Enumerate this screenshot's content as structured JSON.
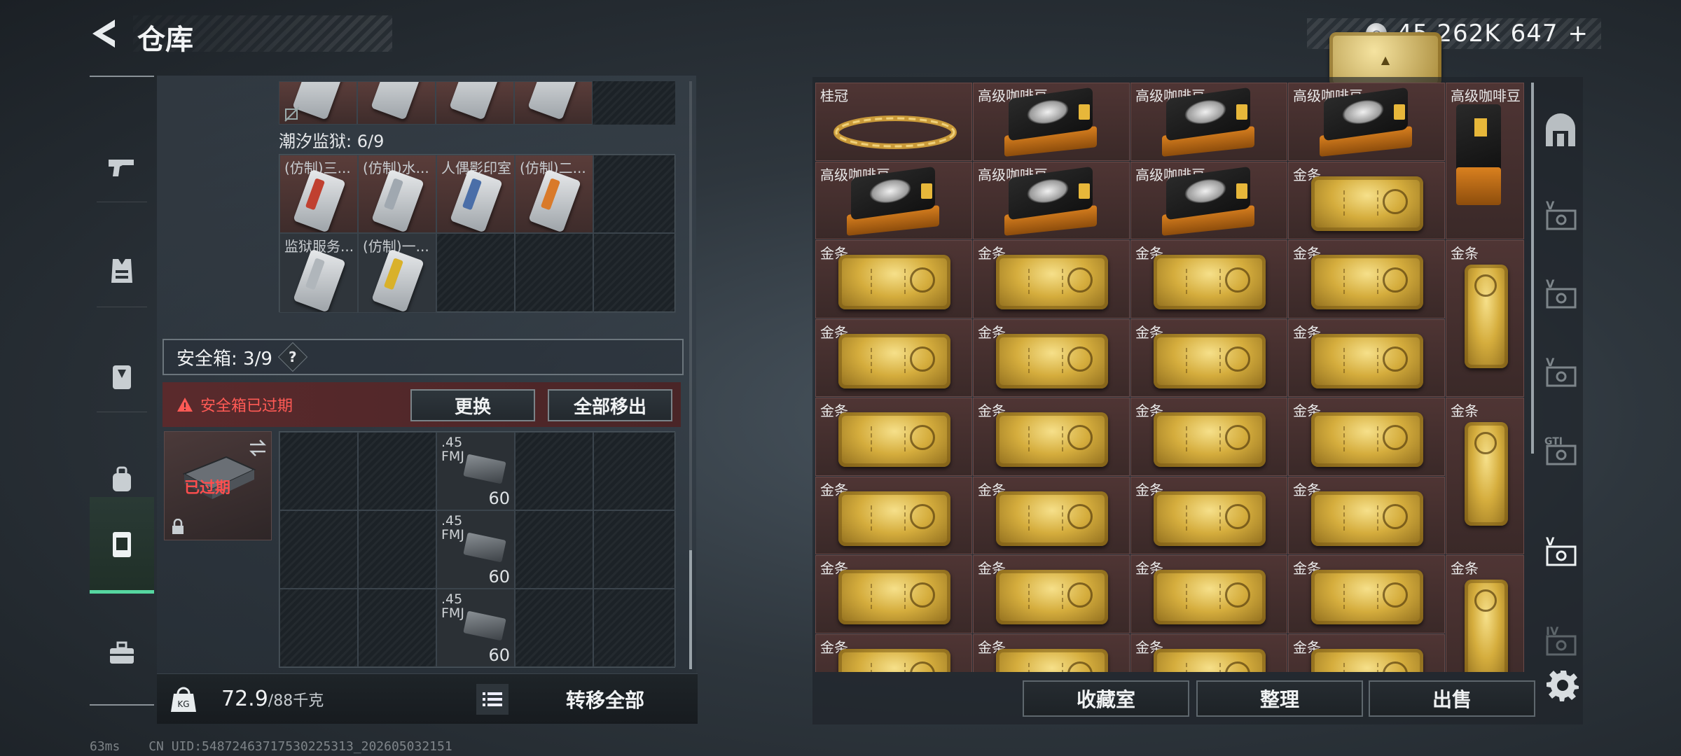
{
  "header": {
    "title": "仓库",
    "currency_silver": "45,262K",
    "currency_gold": "647",
    "add_symbol": "+"
  },
  "left_panel": {
    "prison_label": "潮汐监狱: 6/9",
    "prison_items": [
      {
        "name": "(仿制)三..."
      },
      {
        "name": "(仿制)水..."
      },
      {
        "name": "人偶影印室"
      },
      {
        "name": "(仿制)二..."
      },
      {
        "name": "监狱服务..."
      },
      {
        "name": "(仿制)一..."
      }
    ],
    "safebox_label": "安全箱: 3/9",
    "safebox_help": "?",
    "expired_warning": "安全箱已过期",
    "replace_button": "更换",
    "move_all_out_button": "全部移出",
    "safebox_status": "已过期",
    "ammo": [
      {
        "caliber": ".45",
        "type": "FMJ",
        "count": "60"
      },
      {
        "caliber": ".45",
        "type": "FMJ",
        "count": "60"
      },
      {
        "caliber": ".45",
        "type": "FMJ",
        "count": "60"
      }
    ],
    "weight_current": "72.9",
    "weight_max": "/88千克",
    "transfer_all_button": "转移全部"
  },
  "right_panel": {
    "items": [
      {
        "name": "桂冠",
        "kind": "crown"
      },
      {
        "name": "高级咖啡豆",
        "kind": "coffee"
      },
      {
        "name": "高级咖啡豆",
        "kind": "coffee"
      },
      {
        "name": "高级咖啡豆",
        "kind": "coffee"
      },
      {
        "name": "高级咖啡豆",
        "kind": "coffee-vertical"
      },
      {
        "name": "高级咖啡豆",
        "kind": "coffee"
      },
      {
        "name": "高级咖啡豆",
        "kind": "coffee"
      },
      {
        "name": "高级咖啡豆",
        "kind": "coffee"
      },
      {
        "name": "金条",
        "kind": "gold"
      },
      {
        "name": "金条",
        "kind": "gold"
      },
      {
        "name": "金条",
        "kind": "gold"
      },
      {
        "name": "金条",
        "kind": "gold"
      },
      {
        "name": "金条",
        "kind": "gold"
      },
      {
        "name": "金条",
        "kind": "gold-vertical"
      },
      {
        "name": "金条",
        "kind": "gold"
      },
      {
        "name": "金条",
        "kind": "gold"
      },
      {
        "name": "金条",
        "kind": "gold"
      },
      {
        "name": "金条",
        "kind": "gold"
      },
      {
        "name": "金条",
        "kind": "gold"
      },
      {
        "name": "金条",
        "kind": "gold"
      },
      {
        "name": "金条",
        "kind": "gold"
      },
      {
        "name": "金条",
        "kind": "gold"
      },
      {
        "name": "金条",
        "kind": "gold-vertical"
      },
      {
        "name": "金条",
        "kind": "gold"
      },
      {
        "name": "金条",
        "kind": "gold"
      },
      {
        "name": "金条",
        "kind": "gold"
      },
      {
        "name": "金条",
        "kind": "gold"
      },
      {
        "name": "金条",
        "kind": "gold"
      },
      {
        "name": "金条",
        "kind": "gold"
      },
      {
        "name": "金条",
        "kind": "gold"
      },
      {
        "name": "金条",
        "kind": "gold"
      },
      {
        "name": "金条",
        "kind": "gold-vertical"
      },
      {
        "name": "金条",
        "kind": "gold"
      },
      {
        "name": "金条",
        "kind": "gold"
      },
      {
        "name": "金条",
        "kind": "gold"
      },
      {
        "name": "金条",
        "kind": "gold"
      }
    ],
    "collection_button": "收藏室",
    "sort_button": "整理",
    "sell_button": "出售"
  },
  "left_nav": [
    "pistol-icon",
    "vest-icon",
    "backpack-icon",
    "rig-icon",
    "safebox-icon",
    "toolbox-icon"
  ],
  "right_nav_labels": [
    "V",
    "V",
    "V",
    "GTI",
    "V",
    "IV"
  ],
  "status": {
    "ping": "63ms",
    "uid": "CN UID:5487246371753022531​3_202605032151"
  },
  "colors": {
    "accent_green": "#56d6a0",
    "warning_red": "#ff5a55",
    "item_red_bg": "#4f3534"
  }
}
